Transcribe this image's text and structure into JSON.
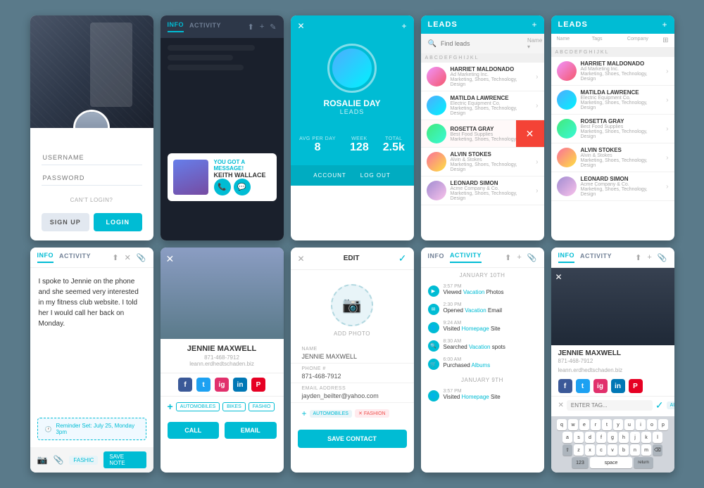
{
  "screens": {
    "s1": {
      "username_placeholder": "USERNAME",
      "password_placeholder": "PASSWORD",
      "cant_login": "CAN'T LOGIN?",
      "signup": "SIGN UP",
      "login": "LOGIN"
    },
    "s2": {
      "tab_info": "INFO",
      "tab_activity": "ACTIVITY",
      "notification_title": "YOU GOT A MESSAGE!",
      "notification_name": "KEITH WALLACE"
    },
    "s3": {
      "name": "ROSALIE DAY",
      "role": "LEADS",
      "stat1_label": "AVG PER DAY",
      "stat1_val": "8",
      "stat2_label": "WEEK",
      "stat2_val": "128",
      "stat3_label": "TOTAL",
      "stat3_val": "2.5k",
      "action1": "ACCOUNT",
      "action2": "LOG OUT"
    },
    "s4": {
      "title": "LEADS",
      "search_placeholder": "Find leads",
      "name_filter": "Name",
      "leads": [
        {
          "name": "HARRIET MALDONADO",
          "company": "Ad Marketing Inc.",
          "tags": "Marketing, Shoes, Technology, Design"
        },
        {
          "name": "MATILDA LAWRENCE",
          "company": "Electric Equipment Co.",
          "tags": "Marketing, Shoes, Technology, Design"
        },
        {
          "name": "ROSETTA GRAY",
          "company": "Best Food Supplies",
          "tags": "Marketing, Shoes, Technology, Design",
          "delete": true
        },
        {
          "name": "ALVIN STOKES",
          "company": "Alvin & Stokes",
          "tags": "Marketing, Shoes, Technology, Design"
        },
        {
          "name": "LEONARD SIMON",
          "company": "Acme Company & Co.",
          "tags": "Marketing, Shoes, Technology, Design"
        }
      ],
      "alpha": [
        "A",
        "B",
        "C",
        "D",
        "E",
        "F",
        "G",
        "H",
        "I",
        "J",
        "K",
        "L"
      ]
    },
    "s5": {
      "title": "LEADS",
      "col1": "Name",
      "col2": "Tags",
      "col3": "Company",
      "leads": [
        {
          "name": "HARRIET MALDONADO",
          "company": "Ad Marketing Inc.",
          "tags": "Marketing, Shoes, Technology, Design"
        },
        {
          "name": "MATILDA LAWRENCE",
          "company": "Electric Equipment Co.",
          "tags": "Marketing, Shoes, Technology, Design"
        },
        {
          "name": "ROSETTA GRAY",
          "company": "Best Food Supplies",
          "tags": "Marketing, Shoes, Technology, Design"
        },
        {
          "name": "ALVIN STOKES",
          "company": "Alvin & Stokes",
          "tags": "Marketing, Shoes, Technology, Design"
        },
        {
          "name": "LEONARD SIMON",
          "company": "Acme Company & Co.",
          "tags": "Marketing, Shoes, Technology, Design"
        }
      ],
      "alpha": [
        "A",
        "B",
        "C",
        "D",
        "E",
        "F",
        "G",
        "H",
        "I",
        "J",
        "K",
        "L"
      ]
    },
    "s6": {
      "tab_info": "INFO",
      "tab_activity": "ACTIVITY",
      "note_text": "I spoke to Jennie on the phone and she seemed very interested in my fitness club website. I told her I would call her back on Monday.",
      "reminder": "Reminder Set: July 25, Monday 3pm",
      "tag": "FASHIC",
      "save_note": "SAVE NOTE"
    },
    "s7": {
      "name": "JENNIE MAXWELL",
      "phone": "871-468-7912",
      "email": "leann.erdhedtschaden.biz",
      "tag1": "AUTOMOBILES",
      "tag2": "BIKES",
      "tag3": "FASHIO",
      "btn_call": "CALL",
      "btn_email": "EMAIL"
    },
    "s8": {
      "header_cancel": "✕",
      "header_title": "EDIT",
      "header_confirm": "✓",
      "add_photo": "ADD PHOTO",
      "field_name_label": "NAME",
      "field_name_val": "JENNIE MAXWELL",
      "field_phone_label": "PHONE #",
      "field_phone_val": "871-468-7912",
      "field_email_label": "EMAIL ADDRESS",
      "field_email_val": "jayden_beilter@yahoo.com",
      "tag1": "AUTOMOBILES",
      "tag2_del": "FASHION",
      "save_btn": "SAVE CONTACT"
    },
    "s9": {
      "tab_info": "INFO",
      "tab_activity": "ACTIVITY",
      "date1": "JANUARY 10TH",
      "activities": [
        {
          "time": "3:57 PM",
          "desc": "Viewed Vacation Photos",
          "link": "Vacation"
        },
        {
          "time": "2:30 PM",
          "desc": "Opened Vacation Email",
          "link": "Vacation"
        },
        {
          "time": "9:24 AM",
          "desc": "Visited Homepage Site",
          "link": "Homepage"
        },
        {
          "time": "8:30 AM",
          "desc": "Searched Vacation spots",
          "link": "Vacation"
        },
        {
          "time": "6:00 AM",
          "desc": "Purchased Albums",
          "link": "Albums"
        }
      ],
      "date2": "JANUARY 9th",
      "activity2": {
        "time": "3:57 PM",
        "desc": "Visited Homepage Site",
        "link": "Homepage"
      }
    },
    "s10": {
      "tab_info": "INFO",
      "tab_activity": "ACTIVITY",
      "name": "JENNIE MAXWELL",
      "phone": "871-468-7912",
      "email": "leann.erdhedtschaden.biz",
      "tag_input_placeholder": "ENTER TAG...",
      "tag_chip": "AUTOMOBI",
      "keyboard_rows": [
        [
          "q",
          "w",
          "e",
          "r",
          "t",
          "y",
          "u",
          "i",
          "o",
          "p"
        ],
        [
          "a",
          "s",
          "d",
          "f",
          "g",
          "h",
          "j",
          "k",
          "l"
        ],
        [
          "⇧",
          "z",
          "x",
          "c",
          "v",
          "b",
          "n",
          "m",
          "⌫"
        ],
        [
          "space",
          "return"
        ]
      ]
    }
  }
}
